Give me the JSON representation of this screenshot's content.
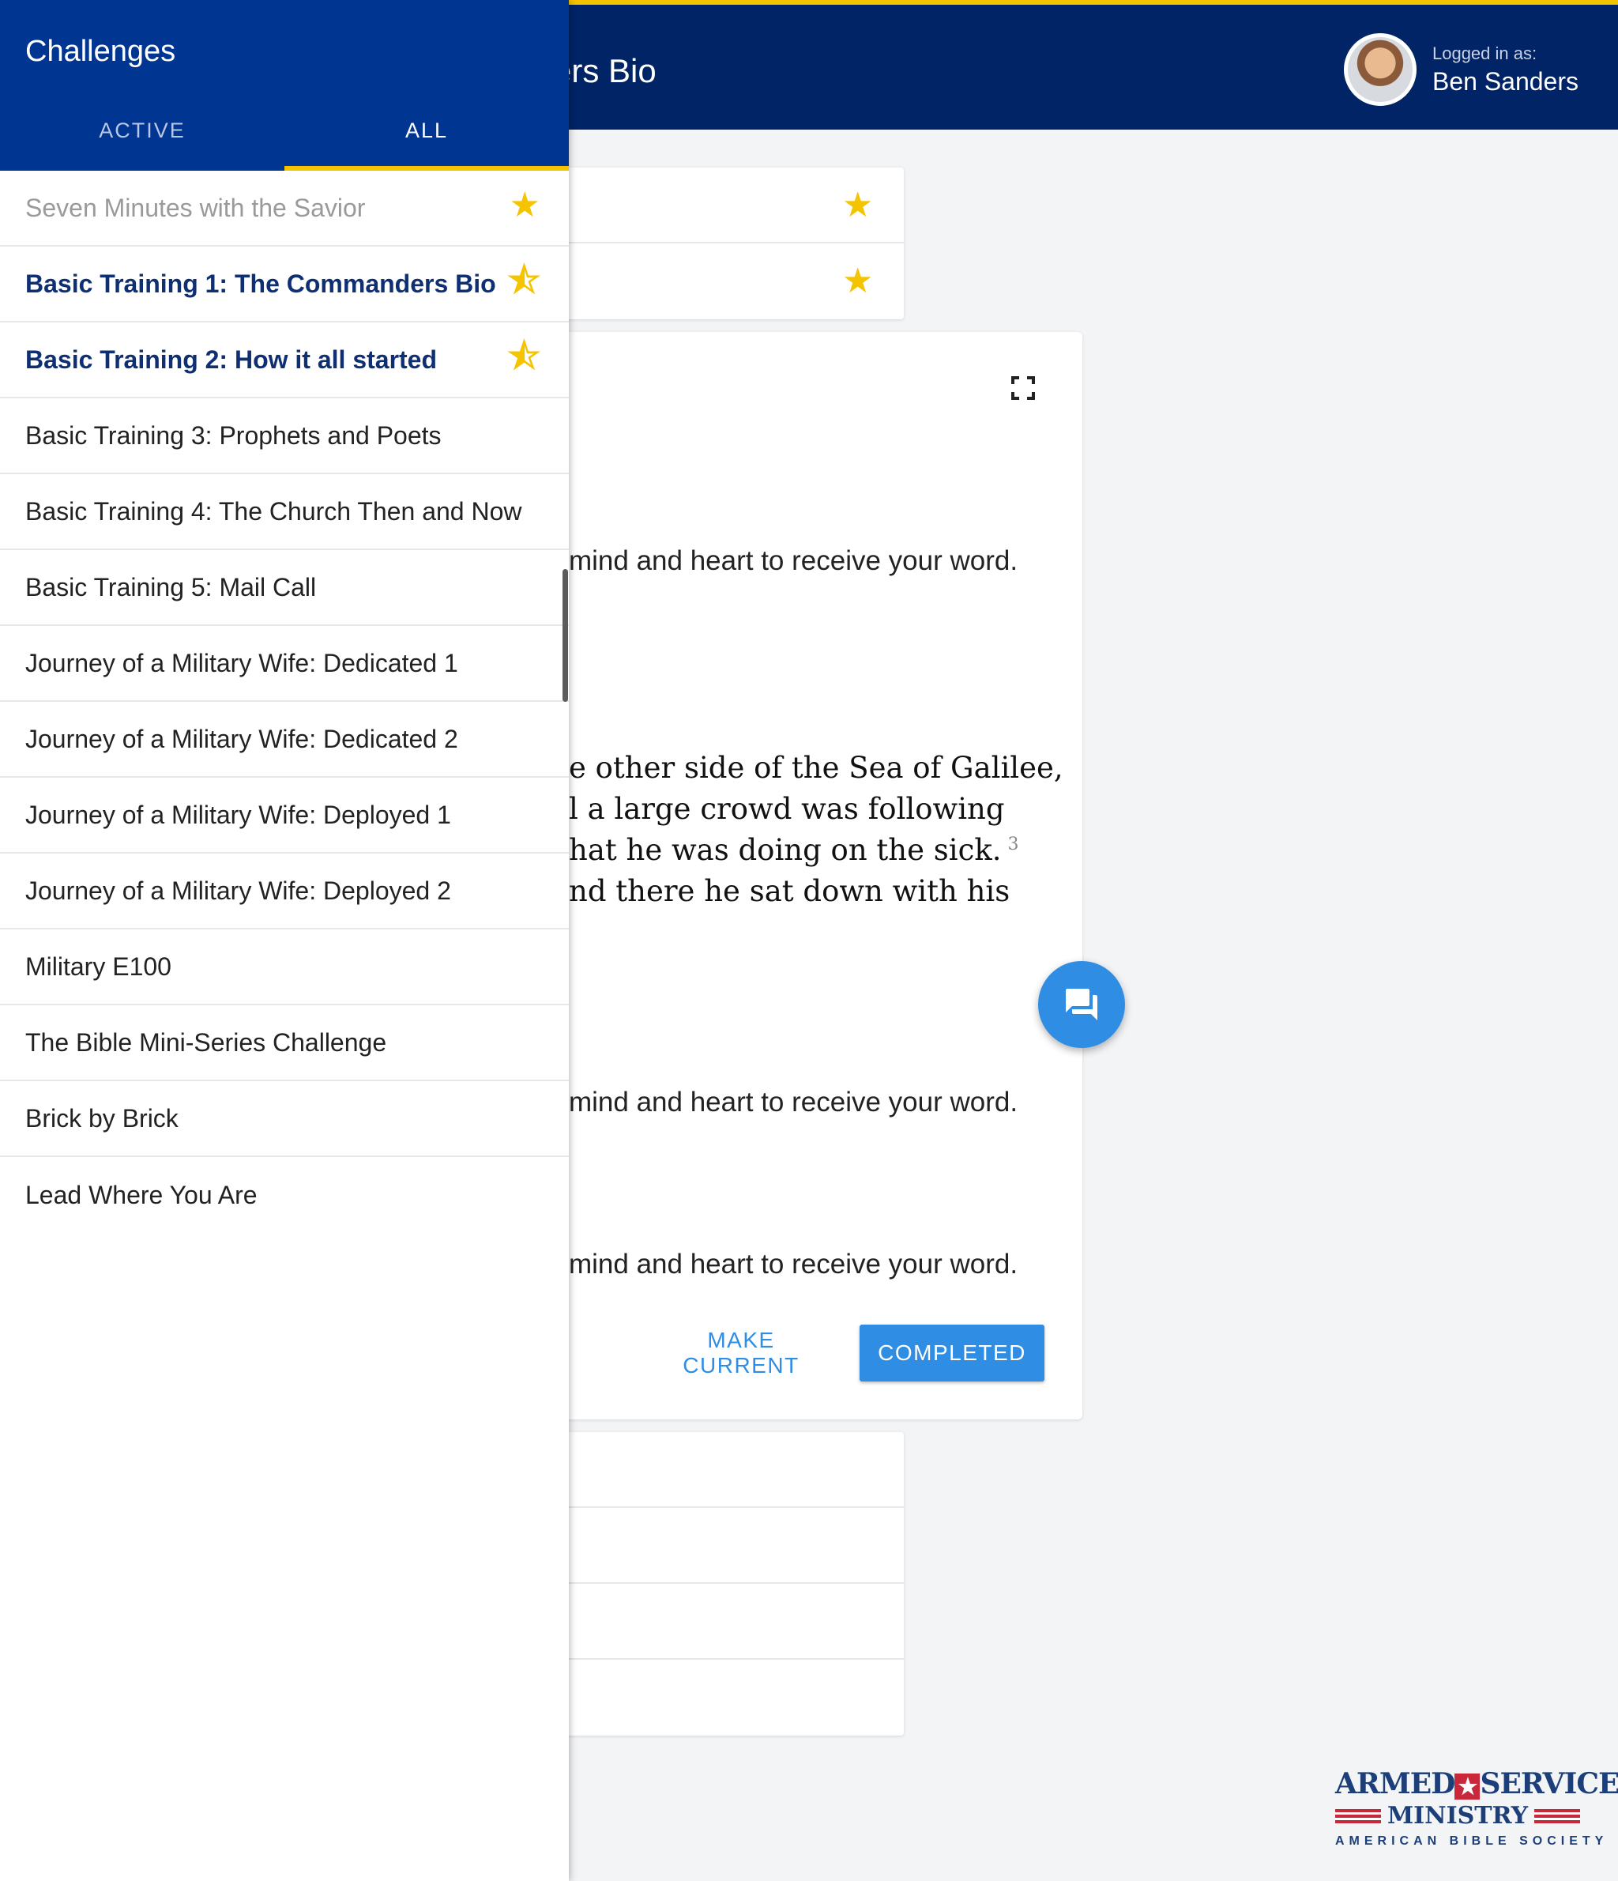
{
  "header": {
    "page_title": "ers Bio",
    "logged_in_label": "Logged in as:",
    "user_name": "Ben Sanders"
  },
  "reading": {
    "lines": [
      "mind and heart to receive your word.",
      "e other side of  the Sea of Galilee,",
      "l a large crowd was following",
      "hat he was doing on the sick.",
      "nd there he sat down with his",
      "mind and heart to receive your word.",
      "mind and heart to receive your word."
    ],
    "verse_number": "3",
    "make_current_label": "MAKE CURRENT",
    "completed_label": "COMPLETED"
  },
  "drawer": {
    "title": "Challenges",
    "tabs": [
      "ACTIVE",
      "ALL"
    ],
    "selected_tab": "ALL",
    "items": [
      {
        "label": "Seven Minutes with the Savior",
        "star": "filled",
        "style": "dim"
      },
      {
        "label": "Basic Training 1: The Commanders Bio",
        "star": "half",
        "style": "bold"
      },
      {
        "label": "Basic Training 2: How it all started",
        "star": "half",
        "style": "bold"
      },
      {
        "label": "Basic Training 3: Prophets and Poets",
        "star": "",
        "style": "normal"
      },
      {
        "label": "Basic Training 4: The Church Then and Now",
        "star": "",
        "style": "normal"
      },
      {
        "label": "Basic Training 5: Mail Call",
        "star": "",
        "style": "normal"
      },
      {
        "label": "Journey of a Military Wife: Dedicated 1",
        "star": "",
        "style": "normal"
      },
      {
        "label": "Journey of a Military Wife: Dedicated 2",
        "star": "",
        "style": "normal"
      },
      {
        "label": "Journey of a Military Wife: Deployed 1",
        "star": "",
        "style": "normal"
      },
      {
        "label": "Journey of a Military Wife: Deployed 2",
        "star": "",
        "style": "normal"
      },
      {
        "label": "Military E100",
        "star": "",
        "style": "normal"
      },
      {
        "label": "The Bible Mini-Series Challenge",
        "star": "",
        "style": "normal"
      },
      {
        "label": "Brick by Brick",
        "star": "",
        "style": "normal"
      },
      {
        "label": "Lead Where You Are",
        "star": "",
        "style": "normal"
      }
    ]
  },
  "logo": {
    "line1_left": "ARMED",
    "line1_right": "SERVICES",
    "line2": "MINISTRY",
    "line3": "AMERICAN BIBLE SOCIETY"
  },
  "icons": {
    "filled_star": "★",
    "half_star": "⯪",
    "chat": "💬"
  },
  "colors": {
    "header_bg": "#002466",
    "drawer_header_bg": "#003592",
    "accent_yellow": "#f5c400",
    "primary_blue": "#2f8de4"
  }
}
